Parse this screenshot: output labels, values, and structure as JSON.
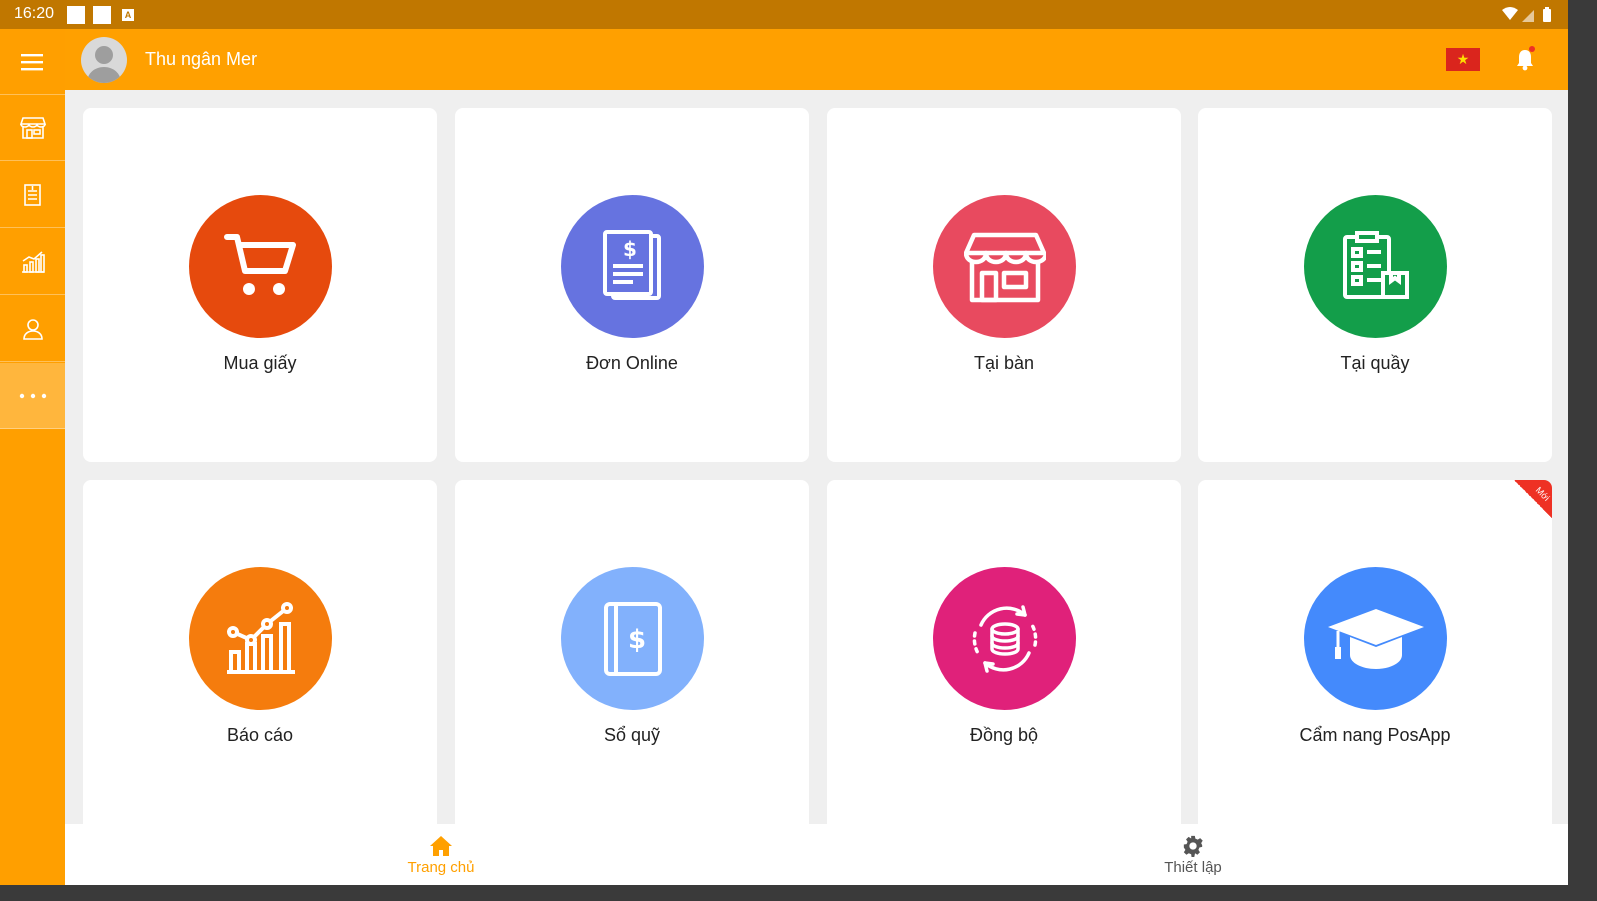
{
  "status_bar": {
    "time": "16:20",
    "notif_badge": "A"
  },
  "header": {
    "user_name": "Thu ngân Mer"
  },
  "tiles": [
    {
      "label": "Mua giấy",
      "color": "#e64a0d",
      "icon": "cart-icon"
    },
    {
      "label": "Đơn Online",
      "color": "#6673e0",
      "icon": "invoice-icon"
    },
    {
      "label": "Tại bàn",
      "color": "#e84a5f",
      "icon": "store-icon"
    },
    {
      "label": "Tại quầy",
      "color": "#139e4a",
      "icon": "checklist-icon"
    },
    {
      "label": "Báo cáo",
      "color": "#f57c0d",
      "icon": "report-chart-icon"
    },
    {
      "label": "Sổ quỹ",
      "color": "#82b1fc",
      "icon": "cashbook-icon"
    },
    {
      "label": "Đồng bộ",
      "color": "#e0217a",
      "icon": "sync-database-icon"
    },
    {
      "label": "Cẩm nang PosApp",
      "color": "#448afc",
      "icon": "graduation-cap-icon",
      "badge": "Mới"
    }
  ],
  "bottom_nav": {
    "home_label": "Trang chủ",
    "settings_label": "Thiết lập"
  },
  "colors": {
    "accent": "#ffa000",
    "status_bar": "#c07700",
    "badge": "#ee3124"
  }
}
